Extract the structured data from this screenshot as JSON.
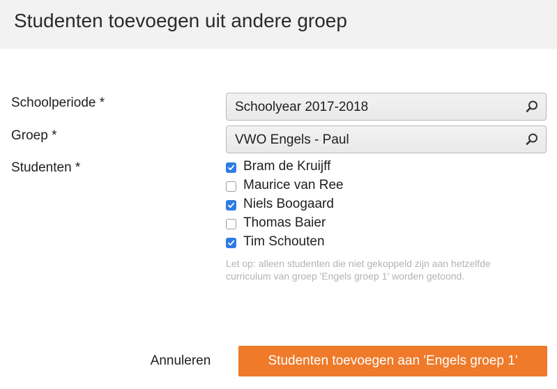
{
  "dialog": {
    "title": "Studenten toevoegen uit andere groep"
  },
  "form": {
    "schoolperiode": {
      "label": "Schoolperiode *",
      "value": "Schoolyear 2017-2018",
      "icon": "search-icon"
    },
    "groep": {
      "label": "Groep *",
      "value": "VWO Engels - Paul",
      "icon": "search-icon"
    },
    "studenten": {
      "label": "Studenten *",
      "items": [
        {
          "name": "Bram de Kruijff",
          "checked": true
        },
        {
          "name": "Maurice van Ree",
          "checked": false
        },
        {
          "name": "Niels Boogaard",
          "checked": true
        },
        {
          "name": "Thomas Baier",
          "checked": false
        },
        {
          "name": "Tim Schouten",
          "checked": true
        }
      ],
      "note": "Let op: alleen studenten die niet gekoppeld zijn aan hetzelfde curriculum van groep 'Engels groep 1' worden getoond."
    }
  },
  "actions": {
    "cancel_label": "Annuleren",
    "submit_label": "Studenten toevoegen aan 'Engels groep 1'"
  },
  "colors": {
    "accent": "#ee7a2a",
    "checkbox_checked": "#2f7be5",
    "header_bg": "#f2f2f2"
  }
}
